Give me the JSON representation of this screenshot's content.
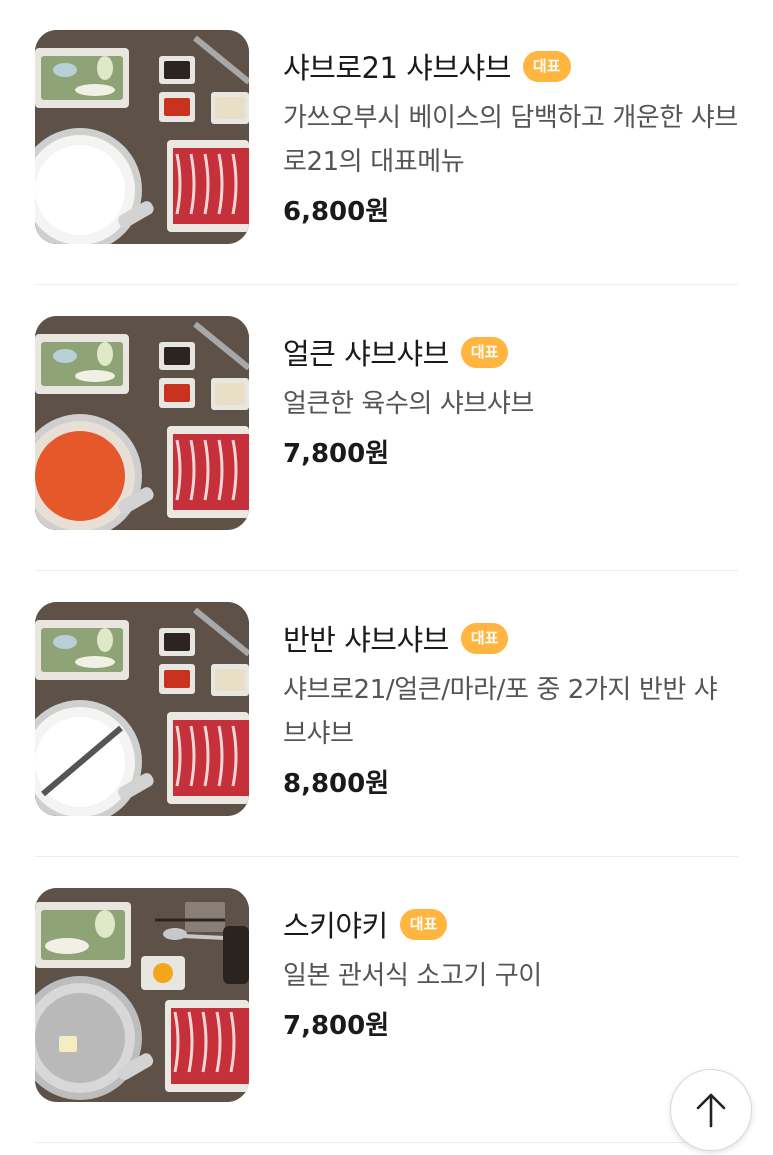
{
  "menu": {
    "items": [
      {
        "title": "샤브로21 샤브샤브",
        "badge": "대표",
        "description": "가쓰오부시 베이스의 담백하고 개운한 샤브로21의 대표메뉴",
        "price": "6,800원",
        "image_icon": "shabu-broth-clear-image"
      },
      {
        "title": "얼큰 샤브샤브",
        "badge": "대표",
        "description": "얼큰한 육수의 샤브샤브",
        "price": "7,800원",
        "image_icon": "shabu-broth-spicy-image"
      },
      {
        "title": "반반 샤브샤브",
        "badge": "대표",
        "description": "샤브로21/얼큰/마라/포 중 2가지 반반 샤브샤브",
        "price": "8,800원",
        "image_icon": "shabu-half-half-image"
      },
      {
        "title": "스키야키",
        "badge": "대표",
        "description": "일본 관서식 소고기 구이",
        "price": "7,800원",
        "image_icon": "sukiyaki-image"
      }
    ]
  },
  "scroll_top": {
    "icon": "arrow-up-icon"
  },
  "colors": {
    "badge": "#ffb53f",
    "title": "#1a1a1a",
    "description": "#555555",
    "divider": "#ececec"
  }
}
